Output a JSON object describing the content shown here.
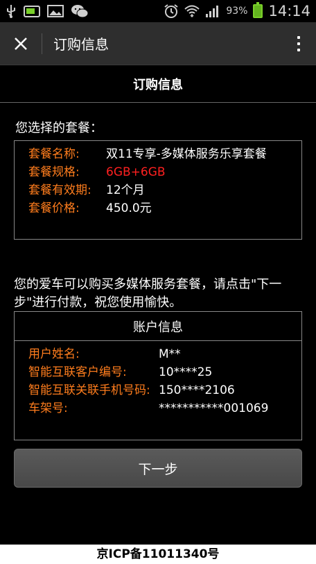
{
  "statusbar": {
    "battery_percent": "93%",
    "time": "14:14",
    "icons": [
      "usb-icon",
      "sd-card-icon",
      "image-icon",
      "wechat-icon",
      "alarm-icon",
      "wifi-icon",
      "signal-icon",
      "battery-icon"
    ]
  },
  "titlebar": {
    "title": "订购信息"
  },
  "section": {
    "header": "订购信息",
    "choose_label": "您选择的套餐："
  },
  "package": {
    "name_label": "套餐名称:",
    "name_value": "双11专享-多媒体服务乐享套餐",
    "spec_label": "套餐规格:",
    "spec_value": "6GB+6GB",
    "validity_label": "套餐有效期:",
    "validity_value": "12个月",
    "price_label": "套餐价格:",
    "price_value": "450.0元",
    "spec_color": "#ff2020",
    "label_color": "#ff7d1d"
  },
  "note": "您的爱车可以购买多媒体服务套餐，请点击\"下一步\"进行付款，祝您使用愉快。",
  "account": {
    "title": "账户信息",
    "rows": [
      {
        "label": "用户姓名:",
        "value": "M**"
      },
      {
        "label": "智能互联客户编号:",
        "value": "10****25"
      },
      {
        "label": "智能互联关联手机号码:",
        "value": "150****2106"
      },
      {
        "label": "车架号:",
        "value": "***********001069"
      }
    ]
  },
  "next_button": "下一步",
  "footer": "京ICP备11011340号"
}
